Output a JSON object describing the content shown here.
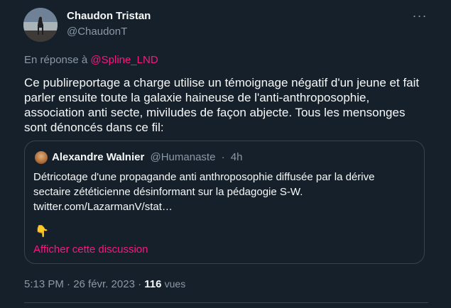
{
  "author": {
    "name": "Chaudon Tristan",
    "handle": "@ChaudonT"
  },
  "more_label": "···",
  "reply": {
    "prefix": "En réponse à",
    "mention": "@Spline_LND"
  },
  "tweet": {
    "text": "Ce publireportage a charge utilise un témoignage négatif d'un jeune et fait parler ensuite toute la galaxie haineuse de l'anti-anthroposophie, association anti secte, miviludes de façon abjecte. Tous les mensonges sont dénoncés dans ce fil:"
  },
  "quote": {
    "name": "Alexandre Walnier",
    "handle": "@Humanaste",
    "separator": "·",
    "time": "4h",
    "text_line1": "Détricotage d'une propagande anti anthroposophie diffusée par la dérive",
    "text_line2": "sectaire zététicienne désinformant sur la pédagogie S-W.",
    "text_line3": "twitter.com/LazarmanV/stat…",
    "emoji": "👇",
    "show_thread": "Afficher cette discussion"
  },
  "footer": {
    "timestamp": "5:13 PM · 26 févr. 2023 ·",
    "views_count": "116",
    "views_label": "vues"
  }
}
